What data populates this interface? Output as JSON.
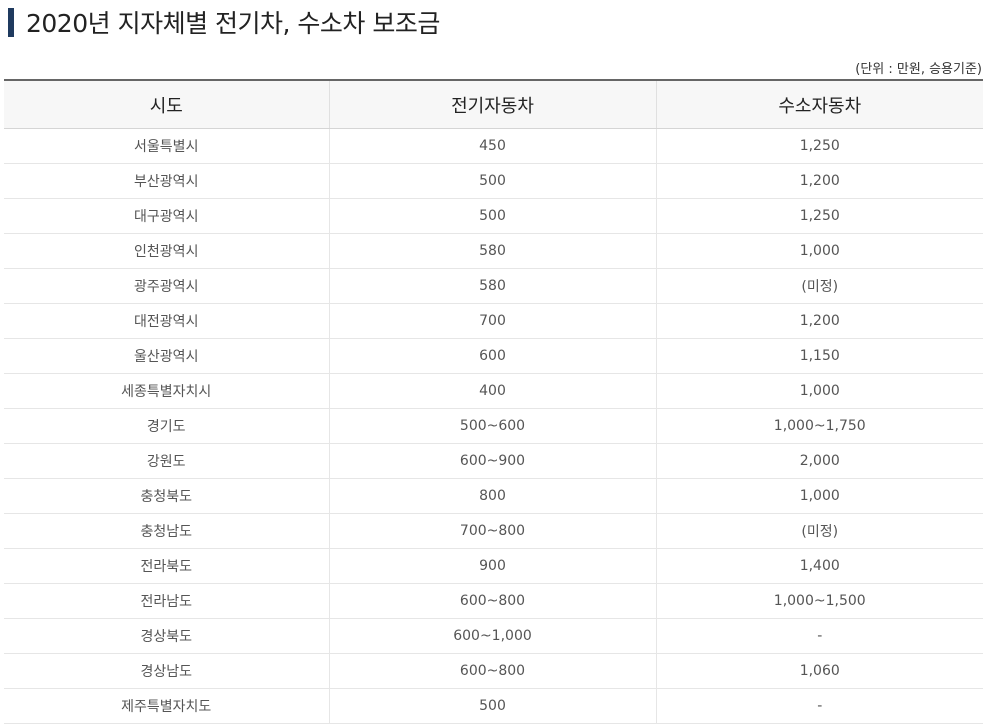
{
  "title": "2020년 지자체별 전기차, 수소차 보조금",
  "unit_note": "(단위 : 만원, 승용기준)",
  "table": {
    "headers": [
      "시도",
      "전기자동차",
      "수소자동차"
    ],
    "rows": [
      [
        "서울특별시",
        "450",
        "1,250"
      ],
      [
        "부산광역시",
        "500",
        "1,200"
      ],
      [
        "대구광역시",
        "500",
        "1,250"
      ],
      [
        "인천광역시",
        "580",
        "1,000"
      ],
      [
        "광주광역시",
        "580",
        "(미정)"
      ],
      [
        "대전광역시",
        "700",
        "1,200"
      ],
      [
        "울산광역시",
        "600",
        "1,150"
      ],
      [
        "세종특별자치시",
        "400",
        "1,000"
      ],
      [
        "경기도",
        "500~600",
        "1,000~1,750"
      ],
      [
        "강원도",
        "600~900",
        "2,000"
      ],
      [
        "충청북도",
        "800",
        "1,000"
      ],
      [
        "충청남도",
        "700~800",
        "(미정)"
      ],
      [
        "전라북도",
        "900",
        "1,400"
      ],
      [
        "전라남도",
        "600~800",
        "1,000~1,500"
      ],
      [
        "경상북도",
        "600~1,000",
        "-"
      ],
      [
        "경상남도",
        "600~800",
        "1,060"
      ],
      [
        "제주특별자치도",
        "500",
        "-"
      ]
    ]
  },
  "colors": {
    "title_accent": "#1f3a5f",
    "header_background": "#f7f7f7"
  }
}
